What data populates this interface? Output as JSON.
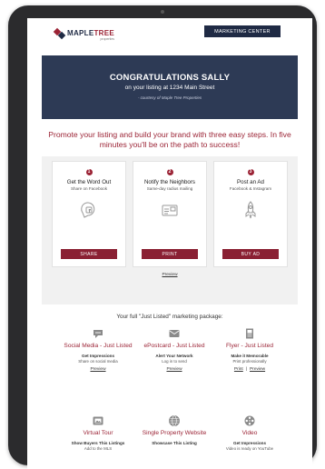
{
  "header": {
    "logo_text_a": "MAPLE",
    "logo_text_b": "TREE",
    "logo_sub": "properties",
    "marketing_center_label": "MARKETING CENTER"
  },
  "banner": {
    "title": "CONGRATULATIONS SALLY",
    "subtitle": "on your listing at 1234 Main Street",
    "credit": "- courtesy of Maple Tree Properties"
  },
  "promo_text": "Promote your listing and build your brand with three easy steps. In five minutes you'll be on the path to success!",
  "steps": [
    {
      "number": "1",
      "title": "Get the Word Out",
      "subtitle": "Share on Facebook",
      "icon": "facebook-badge-icon",
      "button": "SHARE"
    },
    {
      "number": "2",
      "title": "Notify the Neighbors",
      "subtitle": "Same-day radius mailing",
      "icon": "postcard-icon",
      "button": "PRINT",
      "link": "Preview"
    },
    {
      "number": "3",
      "title": "Post an Ad",
      "subtitle": "Facebook & Instagram",
      "icon": "rocket-icon",
      "button": "BUY AD"
    }
  ],
  "package": {
    "title": "Your full \"Just Listed\" marketing package:",
    "items": [
      {
        "name": "Social Media - Just Listed",
        "desc1": "Get Impressions",
        "desc2": "Share on social media",
        "links": [
          "Preview"
        ],
        "icon": "chat-bubble-icon"
      },
      {
        "name": "ePostcard - Just Listed",
        "desc1": "Alert Your Network",
        "desc2": "Log in to send",
        "links": [
          "Preview"
        ],
        "icon": "email-icon"
      },
      {
        "name": "Flyer - Just Listed",
        "desc1": "Make it Memorable",
        "desc2": "Print professionally",
        "links": [
          "Print",
          "Preview"
        ],
        "icon": "flyer-icon"
      },
      {
        "name": "Virtual Tour",
        "desc1": "Show Buyers This Listings",
        "desc2": "Add to the MLS",
        "links": [],
        "icon": "tour-icon"
      },
      {
        "name": "Single Property Website",
        "desc1": "Showcase This Listing",
        "desc2": "",
        "links": [],
        "icon": "globe-icon"
      },
      {
        "name": "Video",
        "desc1": "Get Impressions",
        "desc2": "Video is ready on YouTube",
        "links": [],
        "icon": "film-reel-icon"
      }
    ]
  },
  "colors": {
    "brand_navy": "#1f2a44",
    "brand_red": "#9b2335",
    "banner_bg": "#2d3a55"
  }
}
